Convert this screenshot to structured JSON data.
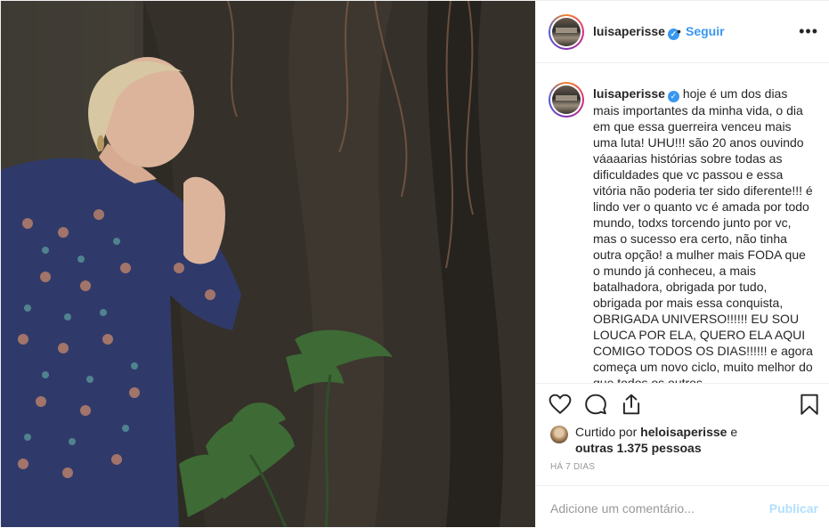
{
  "photo": {
    "description_icon": "photo"
  },
  "header": {
    "username": "luisaperisse",
    "verified_icon": "✓",
    "separator": "•",
    "follow_label": "Seguir",
    "more_icon": "•••"
  },
  "caption": {
    "username": "luisaperisse",
    "text": "hoje é um dos dias mais importantes da minha vida, o dia em que essa guerreira venceu mais uma luta! UHU!!! são 20 anos ouvindo váaaarias histórias sobre todas as dificuldades que vc passou e essa vitória não poderia ter sido diferente!!! é lindo ver o quanto vc é amada por todo mundo, todxs torcendo junto por vc, mas o sucesso era certo, não tinha outra opção! a mulher mais FODA que o mundo já conheceu, a mais batalhadora, obrigada por tudo, obrigada por mais essa conquista, OBRIGADA UNIVERSO!!!!!! EU SOU LOUCA POR ELA, QUERO ELA AQUI COMIGO TODOS OS DIAS!!!!!! e agora começa um novo ciclo, muito melhor do que todos os outros"
  },
  "likes": {
    "prefix": "Curtido por",
    "liker": "heloisaperisse",
    "joiner": "e",
    "others": "outras 1.375 pessoas"
  },
  "timestamp": "HÁ 7 DIAS",
  "comment": {
    "placeholder": "Adicione um comentário...",
    "publish_label": "Publicar"
  },
  "colors": {
    "link_blue": "#3897f0",
    "publish_disabled": "#b2dffc",
    "text": "#262626",
    "muted": "#999999"
  }
}
